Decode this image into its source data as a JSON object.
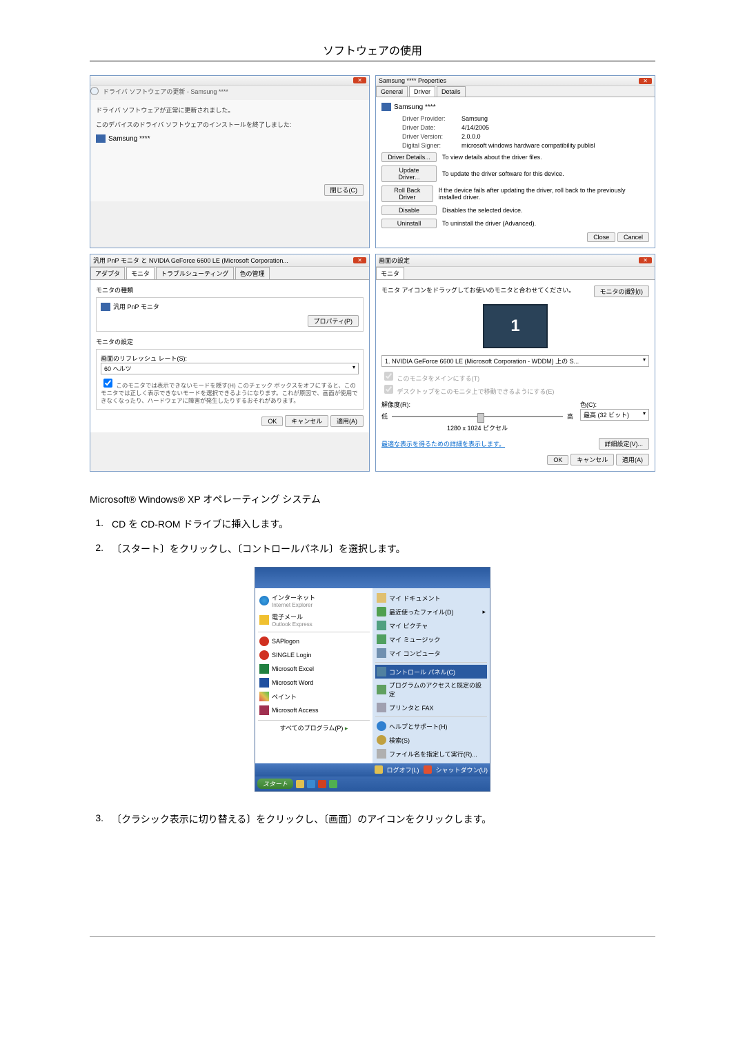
{
  "page_title": "ソフトウェアの使用",
  "win1": {
    "breadcrumb": "ドライバ ソフトウェアの更新 - Samsung ****",
    "line1": "ドライバ ソフトウェアが正常に更新されました。",
    "line2": "このデバイスのドライバ ソフトウェアのインストールを終了しました:",
    "device": "Samsung ****",
    "close": "閉じる(C)"
  },
  "win2": {
    "title": "Samsung **** Properties",
    "tabs": {
      "general": "General",
      "driver": "Driver",
      "details": "Details"
    },
    "device": "Samsung ****",
    "provider_label": "Driver Provider:",
    "provider": "Samsung",
    "date_label": "Driver Date:",
    "date": "4/14/2005",
    "version_label": "Driver Version:",
    "version": "2.0.0.0",
    "signer_label": "Digital Signer:",
    "signer": "microsoft windows hardware compatibility publisl",
    "btn_details": "Driver Details...",
    "btn_details_desc": "To view details about the driver files.",
    "btn_update": "Update Driver...",
    "btn_update_desc": "To update the driver software for this device.",
    "btn_rollback": "Roll Back Driver",
    "btn_rollback_desc": "If the device fails after updating the driver, roll back to the previously installed driver.",
    "btn_disable": "Disable",
    "btn_disable_desc": "Disables the selected device.",
    "btn_uninstall": "Uninstall",
    "btn_uninstall_desc": "To uninstall the driver (Advanced).",
    "close": "Close",
    "cancel": "Cancel"
  },
  "win3": {
    "title": "汎用 PnP モニタ と NVIDIA GeForce 6600 LE (Microsoft Corporation...",
    "tabs": {
      "adapter": "アダプタ",
      "monitor": "モニタ",
      "trouble": "トラブルシューティング",
      "color": "色の管理"
    },
    "group1_title": "モニタの種類",
    "monitor_name": "汎用 PnP モニタ",
    "btn_prop": "プロパティ(P)",
    "group2_title": "モニタの設定",
    "refresh_label": "画面のリフレッシュ レート(S):",
    "refresh_value": "60 ヘルツ",
    "checkbox_text": "このモニタでは表示できないモードを隠す(H)\nこのチェック ボックスをオフにすると、このモニタでは正しく表示できないモードを選択できるようになります。これが原因で、画面が使用できなくなったり、ハードウェアに障害が発生したりするおそれがあります。",
    "ok": "OK",
    "cancel": "キャンセル",
    "apply": "適用(A)"
  },
  "win4": {
    "title": "画面の設定",
    "tab": "モニタ",
    "instruction": "モニタ アイコンをドラッグしてお使いのモニタと合わせてください。",
    "identify": "モニタの識別(I)",
    "display_num": "1",
    "display_select": "1. NVIDIA GeForce 6600 LE (Microsoft Corporation - WDDM) 上の S...",
    "chk1": "このモニタをメインにする(T)",
    "chk2": "デスクトップをこのモニタ上で移動できるようにする(E)",
    "res_label": "解像度(R):",
    "color_label": "色(C):",
    "low": "低",
    "high": "高",
    "color_value": "最高 (32 ビット)",
    "res_value": "1280 x 1024 ピクセル",
    "link": "最適な表示を得るための詳細を表示します。",
    "advanced": "詳細設定(V)...",
    "ok": "OK",
    "cancel": "キャンセル",
    "apply": "適用(A)"
  },
  "text1": "Microsoft® Windows® XP オペレーティング システム",
  "step1": "CD を CD-ROM ドライブに挿入します。",
  "step2": "〔スタート〕をクリックし、〔コントロールパネル〕を選択します。",
  "step3": "〔クラシック表示に切り替える〕をクリックし、〔画面〕のアイコンをクリックします。",
  "start_menu": {
    "left": {
      "ie": "インターネット",
      "ie_sub": "Internet Explorer",
      "mail": "電子メール",
      "mail_sub": "Outlook Express",
      "sap": "SAPlogon",
      "single": "SINGLE Login",
      "excel": "Microsoft Excel",
      "word": "Microsoft Word",
      "paint": "ペイント",
      "access": "Microsoft Access",
      "all": "すべてのプログラム(P)"
    },
    "right": {
      "docs": "マイ ドキュメント",
      "recent": "最近使ったファイル(D)",
      "pics": "マイ ピクチャ",
      "music": "マイ ミュージック",
      "comp": "マイ コンピュータ",
      "cpanel": "コントロール パネル(C)",
      "prog": "プログラムのアクセスと既定の設定",
      "printer": "プリンタと FAX",
      "help": "ヘルプとサポート(H)",
      "search": "検索(S)",
      "run": "ファイル名を指定して実行(R)..."
    },
    "logoff": "ログオフ(L)",
    "shutdown": "シャットダウン(U)",
    "start": "スタート"
  }
}
